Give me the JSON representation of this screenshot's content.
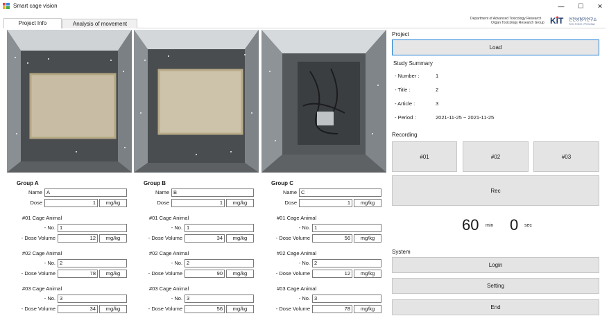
{
  "window": {
    "title": "Smart cage vision",
    "minimize": "—",
    "maximize": "☐",
    "close": "✕"
  },
  "tabs": [
    {
      "label": "Project Info",
      "active": true
    },
    {
      "label": "Analysis of movement",
      "active": false
    }
  ],
  "header": {
    "org_line1": "Department of Advanced Toxicology Research",
    "org_line2": "Organ Toxicology Research Group",
    "logo_text": "KIT",
    "logo_korean": "안전성평가연구소",
    "logo_english": "Korea Institute of Toxicology"
  },
  "groups": [
    {
      "title": "Group A",
      "name_label": "Name",
      "name": "A",
      "dose_label": "Dose",
      "dose": "1",
      "unit": "mg/kg",
      "cages": [
        {
          "title": "#01 Cage Animal",
          "no_label": "- No.",
          "no": "1",
          "dv_label": "- Dose Volume",
          "dv": "12",
          "unit": "mg/kg"
        },
        {
          "title": "#02 Cage Animal",
          "no_label": "- No.",
          "no": "2",
          "dv_label": "- Dose Volume",
          "dv": "78",
          "unit": "mg/kg"
        },
        {
          "title": "#03 Cage Animal",
          "no_label": "- No.",
          "no": "3",
          "dv_label": "- Dose Volume",
          "dv": "34",
          "unit": "mg/kg"
        }
      ]
    },
    {
      "title": "Group B",
      "name_label": "Name",
      "name": "B",
      "dose_label": "Dose",
      "dose": "1",
      "unit": "mg/kg",
      "cages": [
        {
          "title": "#01 Cage Animal",
          "no_label": "- No.",
          "no": "1",
          "dv_label": "- Dose Volume",
          "dv": "34",
          "unit": "mg/kg"
        },
        {
          "title": "#02 Cage Animal",
          "no_label": "- No.",
          "no": "2",
          "dv_label": "- Dose Volume",
          "dv": "90",
          "unit": "mg/kg"
        },
        {
          "title": "#03 Cage Animal",
          "no_label": "- No.",
          "no": "3",
          "dv_label": "- Dose Volume",
          "dv": "56",
          "unit": "mg/kg"
        }
      ]
    },
    {
      "title": "Group C",
      "name_label": "Name",
      "name": "C",
      "dose_label": "Dose",
      "dose": "1",
      "unit": "mg/kg",
      "cages": [
        {
          "title": "#01 Cage Animal",
          "no_label": "- No.",
          "no": "1",
          "dv_label": "- Dose Volume",
          "dv": "56",
          "unit": "mg/kg"
        },
        {
          "title": "#02 Cage Animal",
          "no_label": "- No.",
          "no": "2",
          "dv_label": "- Dose Volume",
          "dv": "12",
          "unit": "mg/kg"
        },
        {
          "title": "#03 Cage Animal",
          "no_label": "- No.",
          "no": "3",
          "dv_label": "- Dose Volume",
          "dv": "78",
          "unit": "mg/kg"
        }
      ]
    }
  ],
  "project": {
    "label": "Project",
    "load_button": "Load",
    "summary_label": "Study Summary",
    "summary": [
      {
        "key": "- Number :",
        "value": "1"
      },
      {
        "key": "- Title :",
        "value": "2"
      },
      {
        "key": "- Article :",
        "value": "3"
      },
      {
        "key": "- Period :",
        "value": "2021-11-25 ~ 2021-11-25"
      }
    ]
  },
  "recording": {
    "label": "Recording",
    "cam_buttons": [
      "#01",
      "#02",
      "#03"
    ],
    "rec_button": "Rec",
    "timer": {
      "minutes": "60",
      "min_unit": "min",
      "seconds": "0",
      "sec_unit": "sec"
    }
  },
  "system": {
    "label": "System",
    "login_button": "Login",
    "setting_button": "Setting",
    "end_button": "End"
  },
  "colors": {
    "accent": "#1c7fd6",
    "button_bg": "#e4e4e4",
    "logo_red": "#e2322b",
    "logo_navy": "#1d3a6e"
  }
}
